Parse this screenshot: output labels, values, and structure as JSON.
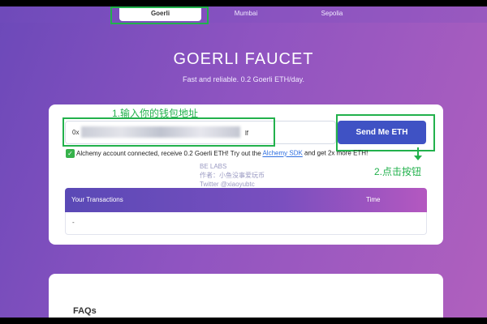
{
  "nav": {
    "tabs": [
      "Goerli",
      "Mumbai",
      "Sepolia"
    ],
    "active_tab": "Goerli"
  },
  "hero": {
    "title": "GOERLI FAUCET",
    "subtitle": "Fast and reliable. 0.2 Goerli ETH/day."
  },
  "form": {
    "address_prefix": "0x",
    "address_suffix": "lf",
    "send_label": "Send Me ETH",
    "notice_text": "Alchemy account connected, receive 0.2 Goerli ETH! Try out the",
    "notice_link": "Alchemy SDK",
    "notice_suffix": "and get 2x more ETH!"
  },
  "annotations": {
    "step1": "1.输入你的钱包地址",
    "step2": "2.点击按钮",
    "color": "#22b14c"
  },
  "watermark": {
    "line1": "BE LABS",
    "line2": "作者：小鱼没事爱玩币",
    "line3": "Twitter @xiaoyubtc"
  },
  "transactions": {
    "col_tx": "Your Transactions",
    "col_time": "Time",
    "empty_value": "-"
  },
  "faq": {
    "title": "FAQs"
  },
  "colors": {
    "primary_button": "#3f52c4",
    "check": "#36b24b",
    "link": "#2f6fe0"
  }
}
